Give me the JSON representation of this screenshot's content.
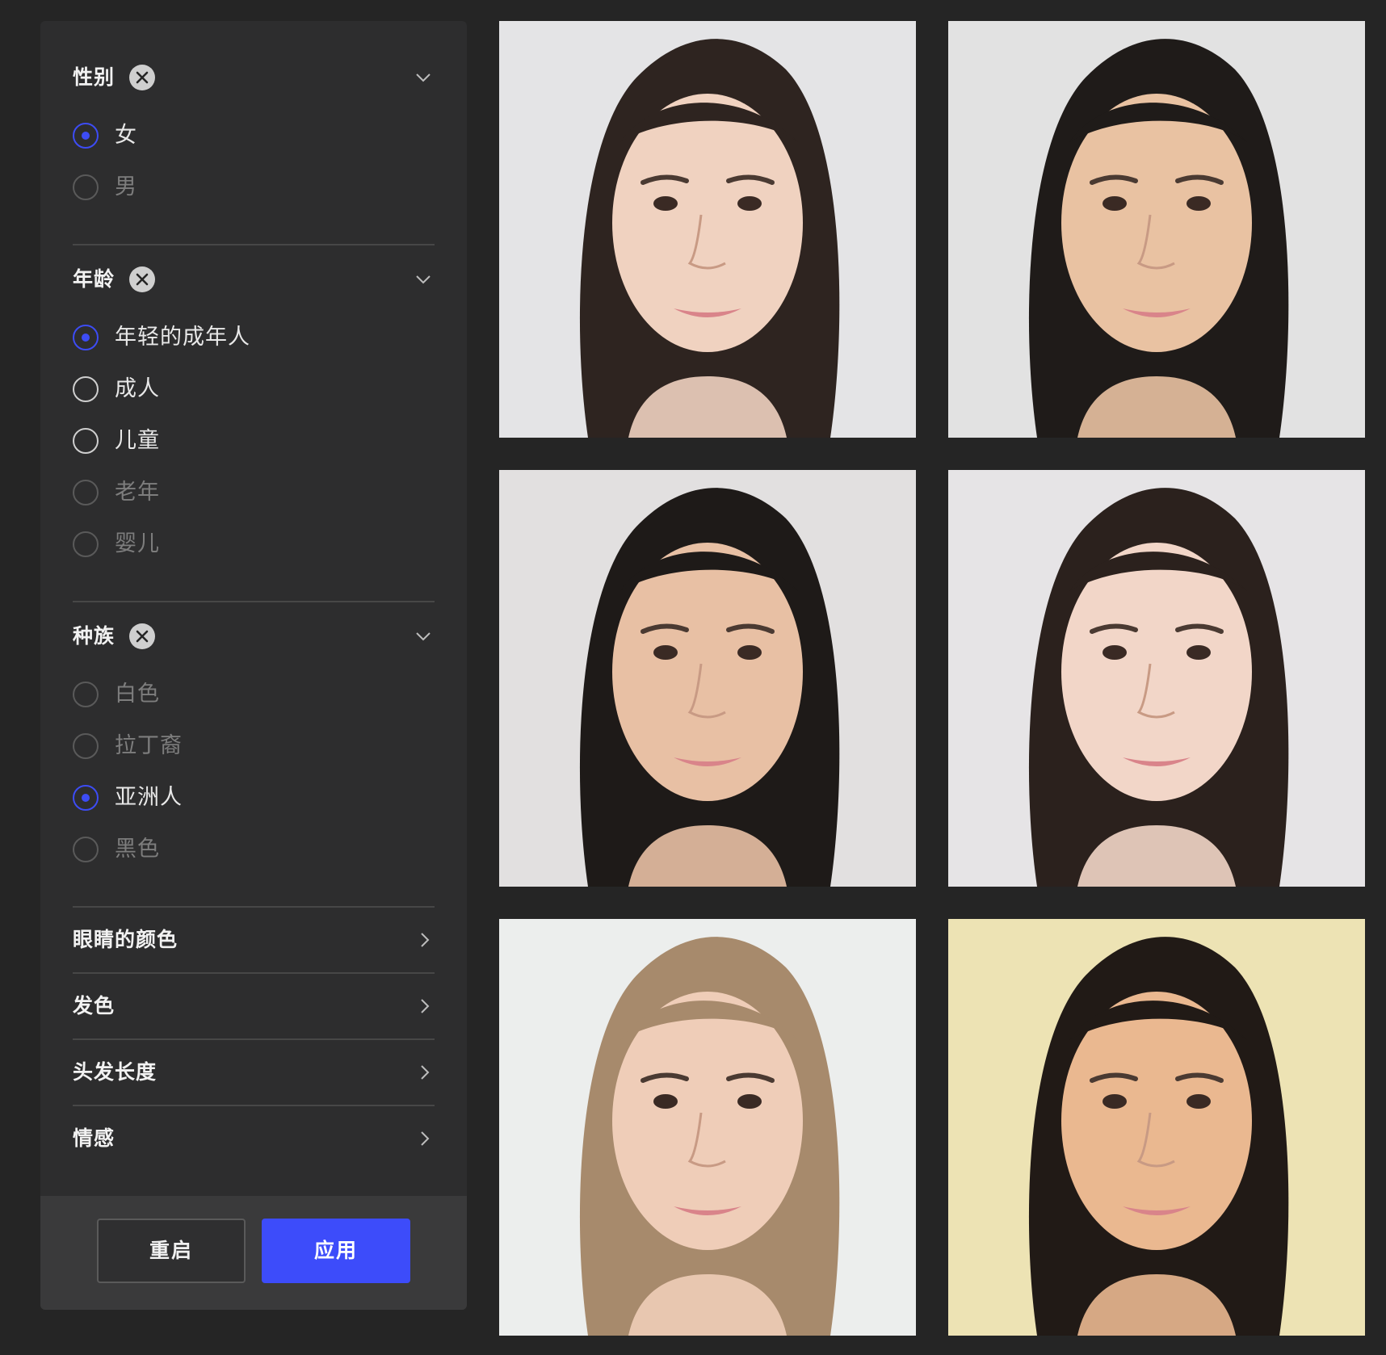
{
  "filters": {
    "gender": {
      "title": "性别",
      "options": [
        {
          "label": "女",
          "state": "selected"
        },
        {
          "label": "男",
          "state": "dimmed"
        }
      ]
    },
    "age": {
      "title": "年龄",
      "options": [
        {
          "label": "年轻的成年人",
          "state": "selected"
        },
        {
          "label": "成人",
          "state": "unselected"
        },
        {
          "label": "儿童",
          "state": "unselected"
        },
        {
          "label": "老年",
          "state": "dimmed"
        },
        {
          "label": "婴儿",
          "state": "dimmed"
        }
      ]
    },
    "ethnicity": {
      "title": "种族",
      "options": [
        {
          "label": "白色",
          "state": "dimmed"
        },
        {
          "label": "拉丁裔",
          "state": "dimmed"
        },
        {
          "label": "亚洲人",
          "state": "selected"
        },
        {
          "label": "黑色",
          "state": "dimmed"
        }
      ]
    },
    "collapsed": [
      {
        "label": "眼睛的颜色"
      },
      {
        "label": "发色"
      },
      {
        "label": "头发长度"
      },
      {
        "label": "情感"
      }
    ]
  },
  "footer": {
    "reset_label": "重启",
    "apply_label": "应用"
  },
  "colors": {
    "accent": "#3d4cfa",
    "panel": "#2d2d2e",
    "background": "#252525"
  },
  "icons": {
    "clear": "close-circle-icon",
    "expand": "chevron-down-icon",
    "collapsed": "chevron-right-icon"
  },
  "gallery": {
    "faces": [
      {
        "hair": "#2e2420",
        "skin": "#f0d2c0",
        "bg": "#e4e4e6"
      },
      {
        "hair": "#1f1b19",
        "skin": "#e9c2a2",
        "bg": "#e2e2e2"
      },
      {
        "hair": "#1e1a18",
        "skin": "#e8c0a4",
        "bg": "#e2e0e0"
      },
      {
        "hair": "#2b211d",
        "skin": "#f2d6c8",
        "bg": "#e6e4e6"
      },
      {
        "hair": "#a78a6c",
        "skin": "#efcdb8",
        "bg": "#eceeed"
      },
      {
        "hair": "#211a16",
        "skin": "#eab890",
        "bg": "#ede3b4"
      }
    ]
  }
}
